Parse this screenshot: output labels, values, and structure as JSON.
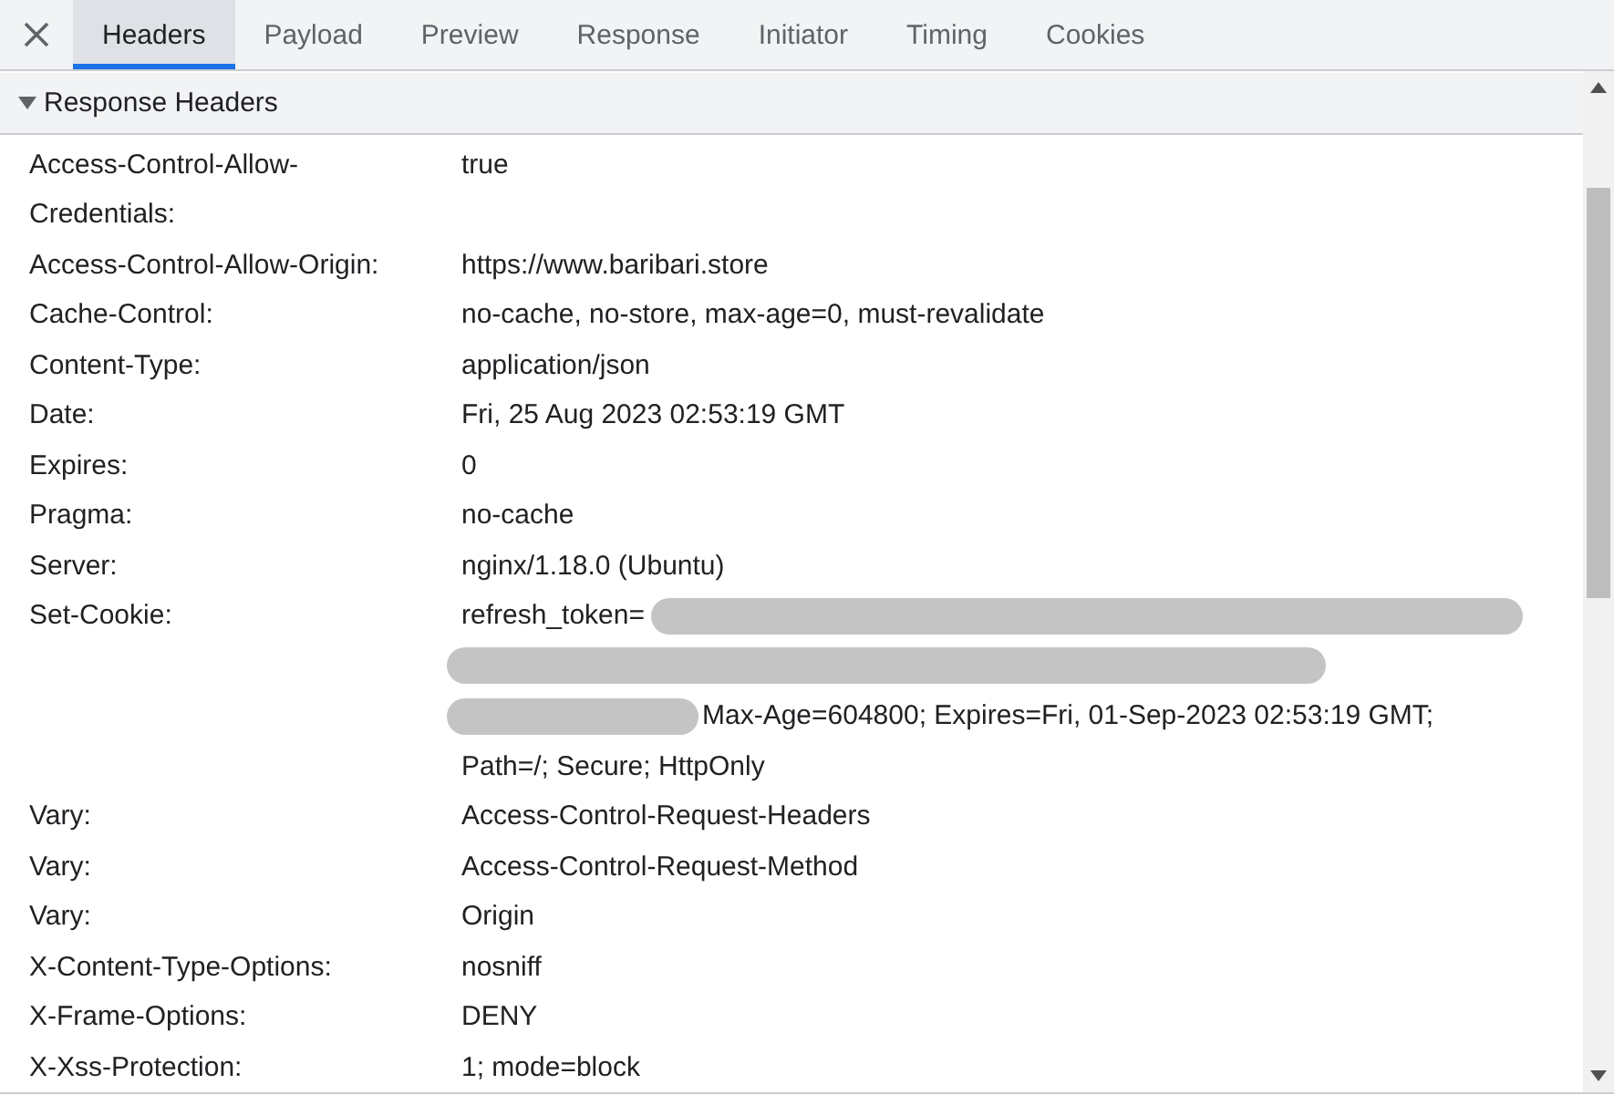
{
  "tabs": [
    {
      "label": "Headers",
      "selected": true
    },
    {
      "label": "Payload",
      "selected": false
    },
    {
      "label": "Preview",
      "selected": false
    },
    {
      "label": "Response",
      "selected": false
    },
    {
      "label": "Initiator",
      "selected": false
    },
    {
      "label": "Timing",
      "selected": false
    },
    {
      "label": "Cookies",
      "selected": false
    }
  ],
  "section": {
    "title": "Response Headers",
    "expanded": true
  },
  "headers": [
    {
      "name": "Access-Control-Allow-Credentials:",
      "lines": [
        {
          "text": "true"
        }
      ]
    },
    {
      "name": "Access-Control-Allow-Origin:",
      "lines": [
        {
          "text": "https://www.baribari.store"
        }
      ]
    },
    {
      "name": "Cache-Control:",
      "lines": [
        {
          "text": "no-cache, no-store, max-age=0, must-revalidate"
        }
      ]
    },
    {
      "name": "Content-Type:",
      "lines": [
        {
          "text": "application/json"
        }
      ]
    },
    {
      "name": "Date:",
      "lines": [
        {
          "text": "Fri, 25 Aug 2023 02:53:19 GMT"
        }
      ]
    },
    {
      "name": "Expires:",
      "lines": [
        {
          "text": "0"
        }
      ]
    },
    {
      "name": "Pragma:",
      "lines": [
        {
          "text": "no-cache"
        }
      ]
    },
    {
      "name": "Server:",
      "lines": [
        {
          "text": "nginx/1.18.0 (Ubuntu)"
        }
      ]
    },
    {
      "name": "Set-Cookie:",
      "lines": [
        {
          "kind": "tailredacted",
          "text": "refresh_token="
        },
        {
          "kind": "redacted"
        },
        {
          "kind": "headredacted",
          "text": "Max-Age=604800; Expires=Fri, 01-Sep-2023 02:53:19 GMT;"
        },
        {
          "text": "Path=/; Secure; HttpOnly"
        }
      ]
    },
    {
      "name": "Vary:",
      "lines": [
        {
          "text": "Access-Control-Request-Headers"
        }
      ]
    },
    {
      "name": "Vary:",
      "lines": [
        {
          "text": "Access-Control-Request-Method"
        }
      ]
    },
    {
      "name": "Vary:",
      "lines": [
        {
          "text": "Origin"
        }
      ]
    },
    {
      "name": "X-Content-Type-Options:",
      "lines": [
        {
          "text": "nosniff"
        }
      ]
    },
    {
      "name": "X-Frame-Options:",
      "lines": [
        {
          "text": "DENY"
        }
      ]
    },
    {
      "name": "X-Xss-Protection:",
      "lines": [
        {
          "text": "1; mode=block"
        }
      ]
    }
  ]
}
